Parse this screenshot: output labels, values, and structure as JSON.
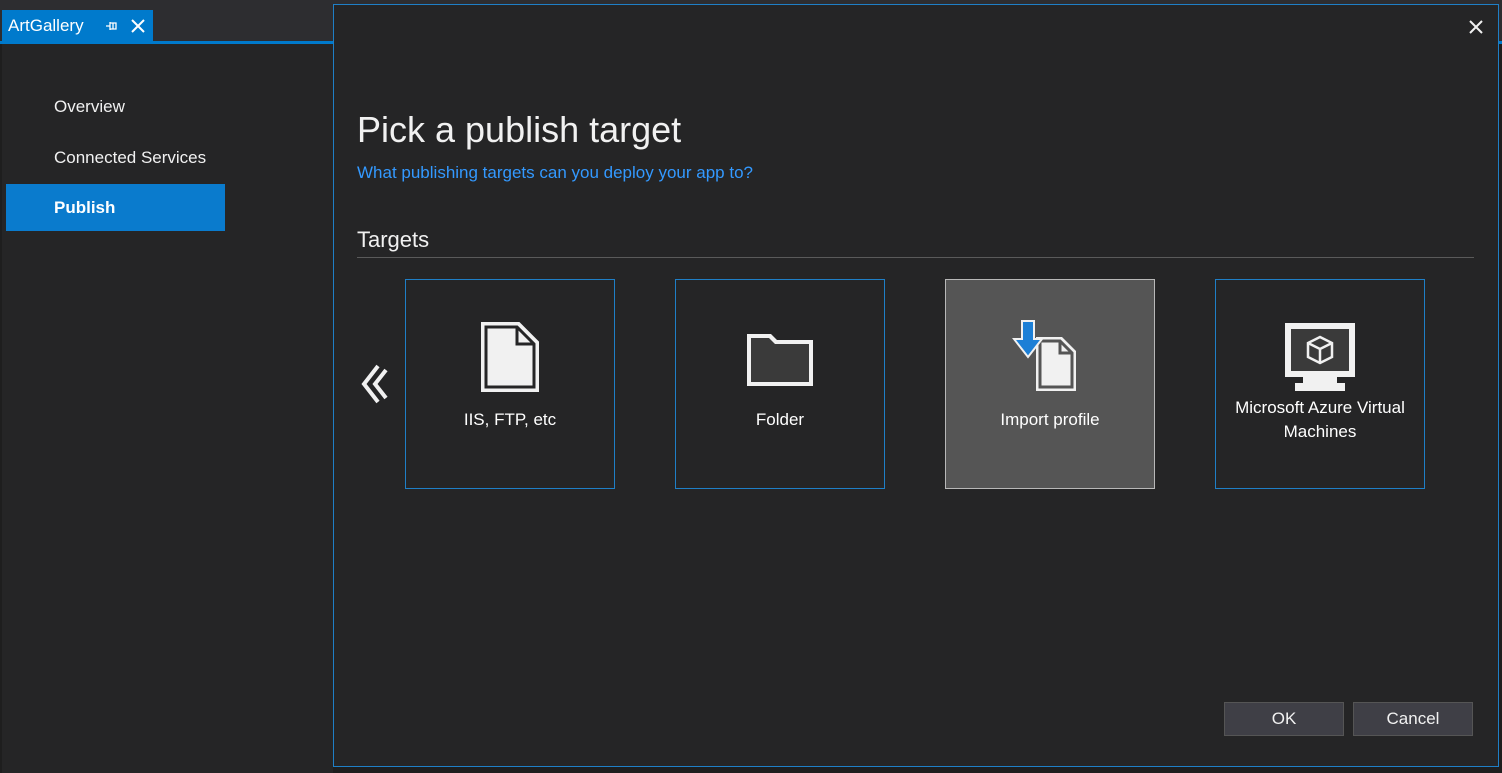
{
  "tab": {
    "title": "ArtGallery",
    "pin_icon": "pin-icon",
    "close_icon": "close-icon"
  },
  "sidebar": {
    "items": [
      {
        "label": "Overview",
        "active": false
      },
      {
        "label": "Connected Services",
        "active": false
      },
      {
        "label": "Publish",
        "active": true
      }
    ]
  },
  "dialog": {
    "close_icon": "close-icon",
    "title": "Pick a publish target",
    "subtitle": "What publishing targets can you deploy your app to?",
    "section_title": "Targets",
    "prev_icon": "chevron-left-icon",
    "targets": [
      {
        "label": "IIS, FTP, etc",
        "icon": "document-icon",
        "selected": false
      },
      {
        "label": "Folder",
        "icon": "folder-icon",
        "selected": false
      },
      {
        "label": "Import profile",
        "icon": "import-profile-icon",
        "selected": true
      },
      {
        "label": "Microsoft Azure Virtual Machines",
        "icon": "virtual-machine-icon",
        "selected": false
      }
    ],
    "ok_label": "OK",
    "cancel_label": "Cancel"
  },
  "colors": {
    "accent": "#007acc",
    "link": "#3399ff",
    "background": "#252526",
    "selected_tile": "#555555"
  }
}
